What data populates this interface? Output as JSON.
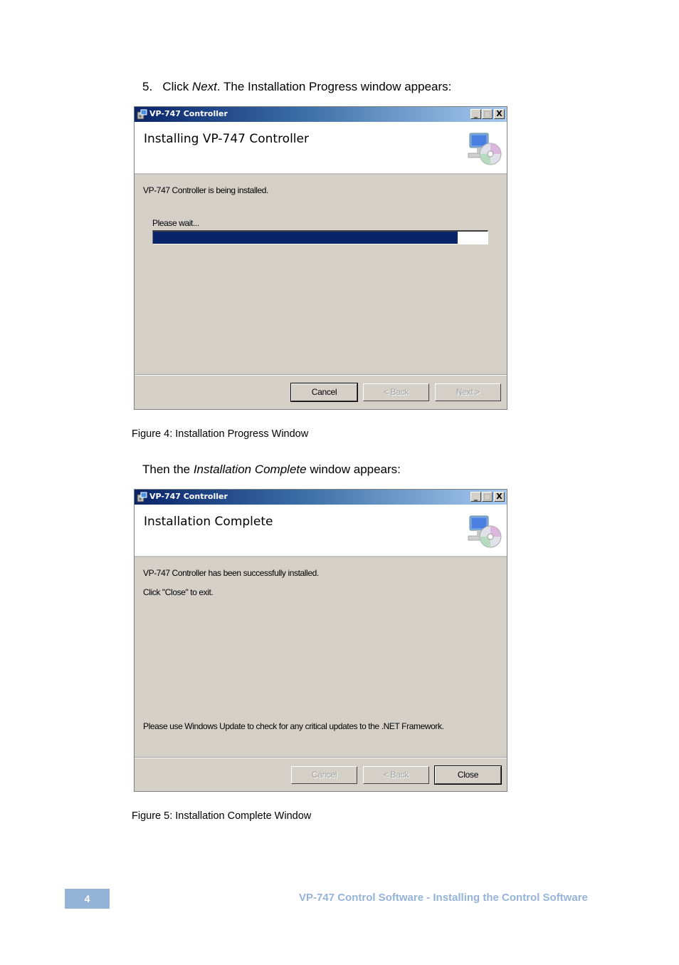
{
  "doc": {
    "step1": {
      "number": "5.",
      "pre": "Click ",
      "italic": "Next",
      "post": ". The Installation Progress window appears:"
    },
    "figure4_caption": "Figure 4: Installation Progress Window",
    "step2": {
      "pre": "Then the ",
      "italic": "Installation Complete",
      "post": " window appears:"
    },
    "figure5_caption": "Figure 5: Installation Complete Window",
    "footer": {
      "page_number": "4",
      "title": "VP-747 Control Software - Installing the Control Software"
    }
  },
  "window1": {
    "title": "VP-747 Controller",
    "header_title": "Installing VP-747 Controller",
    "status_text": "VP-747 Controller is being installed.",
    "progress_label": "Please wait...",
    "progress": 0.91,
    "buttons": {
      "cancel": "Cancel",
      "back": "< Back",
      "next": "Next >"
    }
  },
  "window2": {
    "title": "VP-747 Controller",
    "header_title": "Installation Complete",
    "message": "VP-747 Controller has been successfully installed.",
    "instruction": "Click \"Close\" to exit.",
    "update_note": "Please use Windows Update to check for any critical updates to the .NET Framework.",
    "buttons": {
      "cancel": "Cancel",
      "back": "< Back",
      "close": "Close"
    }
  },
  "titlebar_buttons": {
    "minimize": "_",
    "maximize": "□",
    "close": "X"
  }
}
